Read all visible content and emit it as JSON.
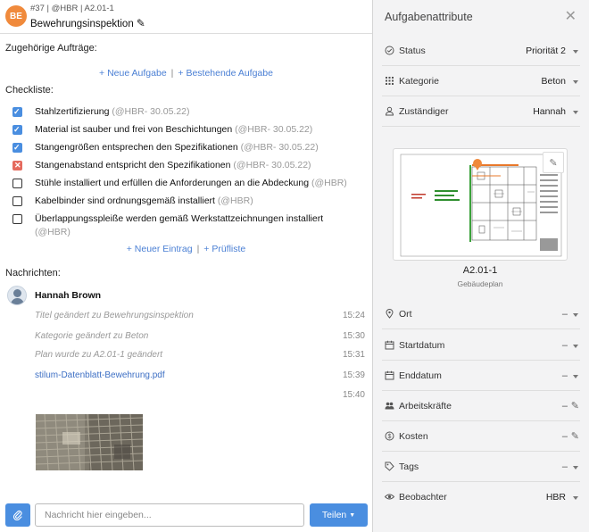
{
  "header": {
    "avatar_initials": "BE",
    "meta": "#37 | @HBR | A2.01-1",
    "title": "Bewehrungsinspektion"
  },
  "related": {
    "label": "Zugehörige Aufträge:",
    "new_task": "+ Neue Aufgabe",
    "existing_task": "+ Bestehende Aufgabe"
  },
  "checklist": {
    "label": "Checkliste:",
    "items": [
      {
        "text": "Stahlzertifizierung",
        "meta": "(@HBR- 30.05.22)",
        "state": "checked"
      },
      {
        "text": "Material ist sauber und frei von Beschichtungen",
        "meta": "(@HBR- 30.05.22)",
        "state": "checked"
      },
      {
        "text": "Stangengrößen entsprechen den Spezifikationen",
        "meta": "(@HBR- 30.05.22)",
        "state": "checked"
      },
      {
        "text": "Stangenabstand entspricht den Spezifikationen",
        "meta": "(@HBR- 30.05.22)",
        "state": "failed"
      },
      {
        "text": "Stühle installiert und erfüllen die Anforderungen an die Abdeckung",
        "meta": "(@HBR)",
        "state": "empty"
      },
      {
        "text": "Kabelbinder sind ordnungsgemäß installiert",
        "meta": "(@HBR)",
        "state": "empty"
      },
      {
        "text": "Überlappungsspleiße werden gemäß Werkstattzeichnungen installiert",
        "meta": "(@HBR)",
        "state": "empty"
      }
    ],
    "new_entry": "+ Neuer Eintrag",
    "checklist_link": "+ Prüfliste"
  },
  "messages": {
    "label": "Nachrichten:",
    "author": "Hannah Brown",
    "entries": [
      {
        "text": "Titel geändert zu Bewehrungsinspektion",
        "time": "15:24"
      },
      {
        "text": "Kategorie geändert zu Beton",
        "time": "15:30"
      },
      {
        "text": "Plan wurde zu A2.01-1 geändert",
        "time": "15:31"
      },
      {
        "text": "stilum-Datenblatt-Bewehrung.pdf",
        "time": "15:39"
      },
      {
        "text": "",
        "time": "15:40"
      }
    ]
  },
  "composer": {
    "placeholder": "Nachricht hier eingeben...",
    "share_label": "Teilen"
  },
  "panel": {
    "title": "Aufgabenattribute",
    "status": {
      "label": "Status",
      "value": "Priorität 2"
    },
    "category": {
      "label": "Kategorie",
      "value": "Beton"
    },
    "assignee": {
      "label": "Zuständiger",
      "value": "Hannah"
    },
    "plan": {
      "name": "A2.01-1",
      "type": "Gebäudeplan"
    },
    "location": {
      "label": "Ort",
      "value": "–"
    },
    "start": {
      "label": "Startdatum",
      "value": "–"
    },
    "end": {
      "label": "Enddatum",
      "value": "–"
    },
    "workers": {
      "label": "Arbeitskräfte",
      "value": "–"
    },
    "costs": {
      "label": "Kosten",
      "value": "–"
    },
    "tags": {
      "label": "Tags",
      "value": "–"
    },
    "watchers": {
      "label": "Beobachter",
      "value": "HBR"
    }
  },
  "colors": {
    "accent": "#4a8ee0",
    "avatar": "#f08a3c",
    "failed": "#e56a5d",
    "link": "#4a7fd4"
  }
}
